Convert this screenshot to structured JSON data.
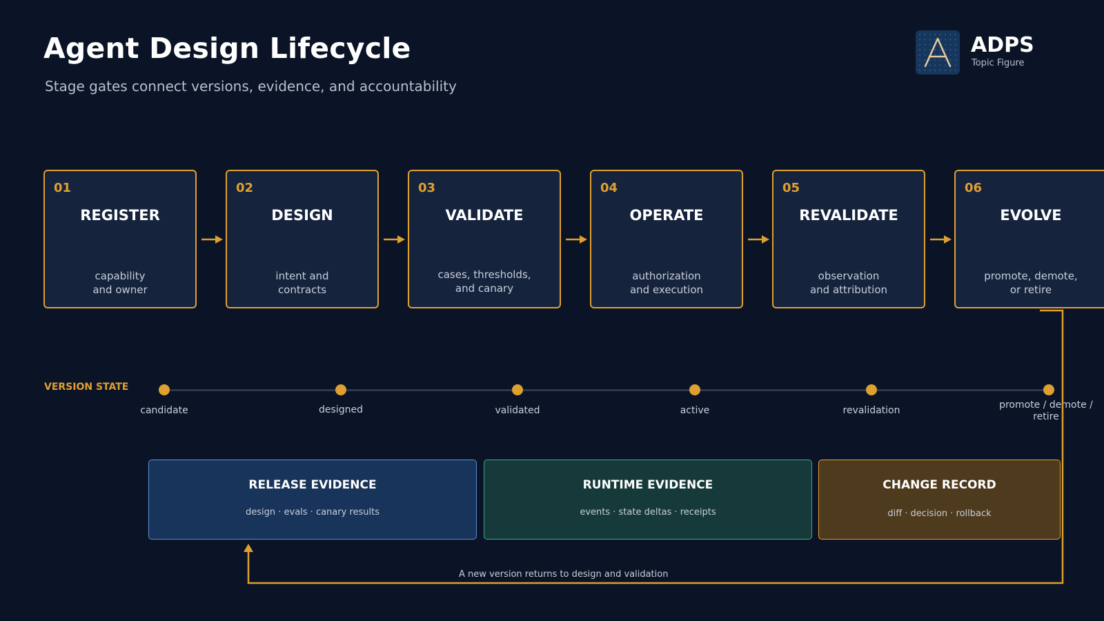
{
  "header": {
    "title": "Agent Design Lifecycle",
    "subtitle": "Stage gates connect versions, evidence, and accountability"
  },
  "logo": {
    "name": "ADPS",
    "subtitle": "Topic Figure",
    "mark": "A"
  },
  "stages": [
    {
      "number": "01",
      "name": "REGISTER",
      "desc_line1": "capability",
      "desc_line2": "and owner"
    },
    {
      "number": "02",
      "name": "DESIGN",
      "desc_line1": "intent and",
      "desc_line2": "contracts"
    },
    {
      "number": "03",
      "name": "VALIDATE",
      "desc_line1": "cases, thresholds,",
      "desc_line2": "and canary"
    },
    {
      "number": "04",
      "name": "OPERATE",
      "desc_line1": "authorization",
      "desc_line2": "and execution"
    },
    {
      "number": "05",
      "name": "REVALIDATE",
      "desc_line1": "observation",
      "desc_line2": "and attribution"
    },
    {
      "number": "06",
      "name": "EVOLVE",
      "desc_line1": "promote, demote,",
      "desc_line2": "or retire"
    }
  ],
  "version_state": {
    "label": "VERSION STATE",
    "states": [
      {
        "line1": "candidate",
        "line2": ""
      },
      {
        "line1": "designed",
        "line2": ""
      },
      {
        "line1": "validated",
        "line2": ""
      },
      {
        "line1": "active",
        "line2": ""
      },
      {
        "line1": "revalidation",
        "line2": ""
      },
      {
        "line1": "promote / demote /",
        "line2": "retire"
      }
    ]
  },
  "evidence": {
    "release": {
      "title": "RELEASE EVIDENCE",
      "desc": "design · evals · canary results"
    },
    "runtime": {
      "title": "RUNTIME EVIDENCE",
      "desc": "events · state deltas · receipts"
    },
    "change": {
      "title": "CHANGE RECORD",
      "desc": "diff · decision · rollback"
    }
  },
  "loop": {
    "label": "A new version returns to design and validation"
  },
  "colors": {
    "background": "#0b1426",
    "accent": "#e0a030",
    "stage_fill": "#16233d",
    "release_fill": "#18345a",
    "runtime_fill": "#163a3a",
    "change_fill": "#4e3a1d"
  }
}
